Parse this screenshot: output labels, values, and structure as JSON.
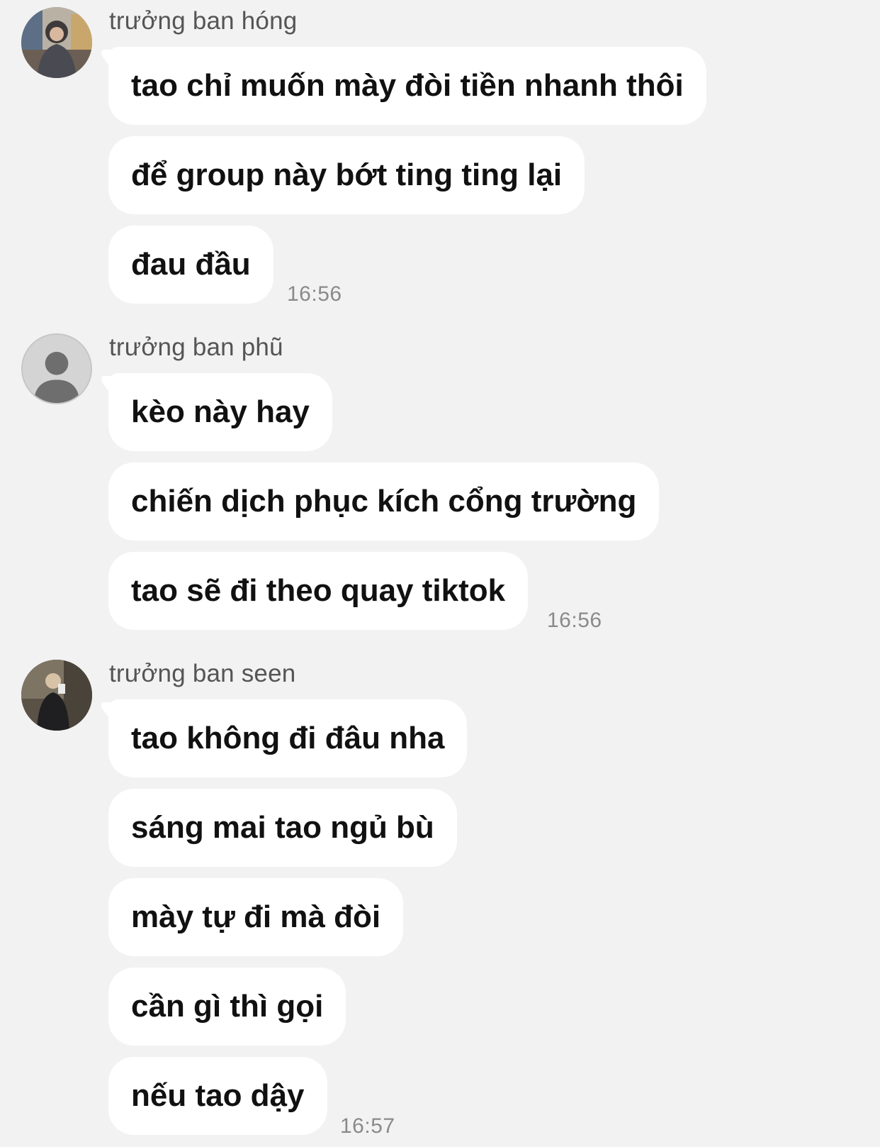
{
  "groups": [
    {
      "sender": "trưởng ban hóng",
      "avatar": "photo-avatar-hoodie",
      "messages": [
        "tao chỉ muốn mày đòi tiền nhanh thôi",
        "để group này bớt ting ting lại",
        "đau đầu"
      ],
      "time": "16:56"
    },
    {
      "sender": "trưởng ban phũ",
      "avatar": "default-person-avatar",
      "messages": [
        "kèo này hay",
        "chiến dịch phục kích cổng trường",
        "tao sẽ đi theo quay tiktok"
      ],
      "time": "16:56"
    },
    {
      "sender": "trưởng ban seen",
      "avatar": "photo-avatar-mirror-selfie",
      "messages": [
        "tao không đi đâu nha",
        "sáng mai tao ngủ bù",
        "mày tự đi mà đòi",
        "cần gì thì gọi",
        "nếu tao dậy"
      ],
      "time": "16:57"
    }
  ],
  "colors": {
    "background": "#f2f2f2",
    "bubble": "#ffffff",
    "message_text": "#111111",
    "sender_text": "#555555",
    "time_text": "#8a8a8a"
  }
}
